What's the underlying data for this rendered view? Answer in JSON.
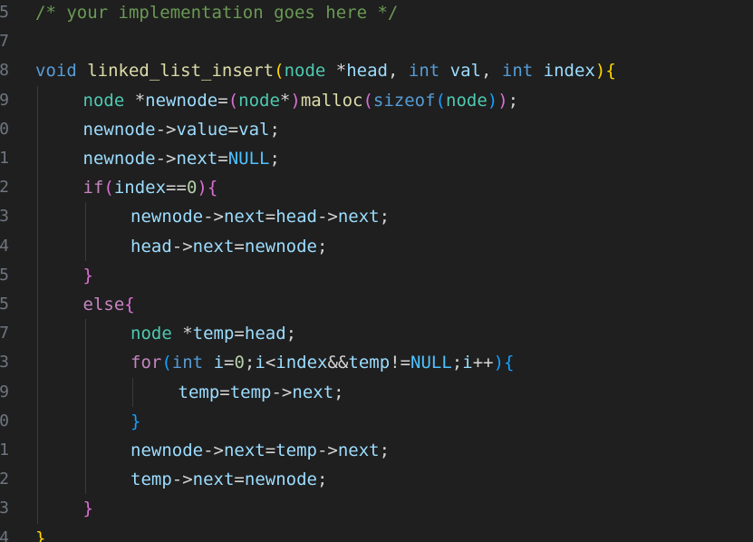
{
  "editor": {
    "lines": [
      {
        "num": "5",
        "indent": 0,
        "tokens": [
          {
            "t": "/* your implementation goes here */",
            "k": "comment"
          }
        ]
      },
      {
        "num": "7",
        "indent": 0,
        "tokens": []
      },
      {
        "num": "8",
        "indent": 0,
        "tokens": [
          {
            "t": "void",
            "k": "keyword"
          },
          {
            "t": " ",
            "k": "plain"
          },
          {
            "t": "linked_list_insert",
            "k": "func"
          },
          {
            "t": "(",
            "k": "brace1"
          },
          {
            "t": "node",
            "k": "type"
          },
          {
            "t": " *",
            "k": "plain"
          },
          {
            "t": "head",
            "k": "var"
          },
          {
            "t": ", ",
            "k": "plain"
          },
          {
            "t": "int",
            "k": "keyword"
          },
          {
            "t": " ",
            "k": "plain"
          },
          {
            "t": "val",
            "k": "var"
          },
          {
            "t": ", ",
            "k": "plain"
          },
          {
            "t": "int",
            "k": "keyword"
          },
          {
            "t": " ",
            "k": "plain"
          },
          {
            "t": "index",
            "k": "var"
          },
          {
            "t": ")",
            "k": "brace1"
          },
          {
            "t": "{",
            "k": "brace1"
          }
        ]
      },
      {
        "num": "9",
        "indent": 1,
        "tokens": [
          {
            "t": "node",
            "k": "type"
          },
          {
            "t": " *",
            "k": "plain"
          },
          {
            "t": "newnode",
            "k": "var"
          },
          {
            "t": "=",
            "k": "plain"
          },
          {
            "t": "(",
            "k": "brace2"
          },
          {
            "t": "node",
            "k": "type"
          },
          {
            "t": "*",
            "k": "plain"
          },
          {
            "t": ")",
            "k": "brace2"
          },
          {
            "t": "malloc",
            "k": "func"
          },
          {
            "t": "(",
            "k": "brace2"
          },
          {
            "t": "sizeof",
            "k": "keyword"
          },
          {
            "t": "(",
            "k": "brace3"
          },
          {
            "t": "node",
            "k": "type"
          },
          {
            "t": ")",
            "k": "brace3"
          },
          {
            "t": ")",
            "k": "brace2"
          },
          {
            "t": ";",
            "k": "plain"
          }
        ]
      },
      {
        "num": "0",
        "indent": 1,
        "tokens": [
          {
            "t": "newnode",
            "k": "var"
          },
          {
            "t": "->",
            "k": "plain"
          },
          {
            "t": "value",
            "k": "var"
          },
          {
            "t": "=",
            "k": "plain"
          },
          {
            "t": "val",
            "k": "var"
          },
          {
            "t": ";",
            "k": "plain"
          }
        ]
      },
      {
        "num": "1",
        "indent": 1,
        "tokens": [
          {
            "t": "newnode",
            "k": "var"
          },
          {
            "t": "->",
            "k": "plain"
          },
          {
            "t": "next",
            "k": "var"
          },
          {
            "t": "=",
            "k": "plain"
          },
          {
            "t": "NULL",
            "k": "const"
          },
          {
            "t": ";",
            "k": "plain"
          }
        ]
      },
      {
        "num": "2",
        "indent": 1,
        "tokens": [
          {
            "t": "if",
            "k": "control"
          },
          {
            "t": "(",
            "k": "brace2"
          },
          {
            "t": "index",
            "k": "var"
          },
          {
            "t": "==",
            "k": "plain"
          },
          {
            "t": "0",
            "k": "num"
          },
          {
            "t": ")",
            "k": "brace2"
          },
          {
            "t": "{",
            "k": "brace2"
          }
        ]
      },
      {
        "num": "3",
        "indent": 2,
        "tokens": [
          {
            "t": "newnode",
            "k": "var"
          },
          {
            "t": "->",
            "k": "plain"
          },
          {
            "t": "next",
            "k": "var"
          },
          {
            "t": "=",
            "k": "plain"
          },
          {
            "t": "head",
            "k": "var"
          },
          {
            "t": "->",
            "k": "plain"
          },
          {
            "t": "next",
            "k": "var"
          },
          {
            "t": ";",
            "k": "plain"
          }
        ]
      },
      {
        "num": "4",
        "indent": 2,
        "tokens": [
          {
            "t": "head",
            "k": "var"
          },
          {
            "t": "->",
            "k": "plain"
          },
          {
            "t": "next",
            "k": "var"
          },
          {
            "t": "=",
            "k": "plain"
          },
          {
            "t": "newnode",
            "k": "var"
          },
          {
            "t": ";",
            "k": "plain"
          }
        ]
      },
      {
        "num": "5",
        "indent": 1,
        "tokens": [
          {
            "t": "}",
            "k": "brace2"
          }
        ]
      },
      {
        "num": "5",
        "indent": 1,
        "tokens": [
          {
            "t": "else",
            "k": "control"
          },
          {
            "t": "{",
            "k": "brace2"
          }
        ]
      },
      {
        "num": "7",
        "indent": 2,
        "tokens": [
          {
            "t": "node",
            "k": "type"
          },
          {
            "t": " *",
            "k": "plain"
          },
          {
            "t": "temp",
            "k": "var"
          },
          {
            "t": "=",
            "k": "plain"
          },
          {
            "t": "head",
            "k": "var"
          },
          {
            "t": ";",
            "k": "plain"
          }
        ]
      },
      {
        "num": "3",
        "indent": 2,
        "tokens": [
          {
            "t": "for",
            "k": "control"
          },
          {
            "t": "(",
            "k": "brace3"
          },
          {
            "t": "int",
            "k": "keyword"
          },
          {
            "t": " ",
            "k": "plain"
          },
          {
            "t": "i",
            "k": "var"
          },
          {
            "t": "=",
            "k": "plain"
          },
          {
            "t": "0",
            "k": "num"
          },
          {
            "t": ";",
            "k": "plain"
          },
          {
            "t": "i",
            "k": "var"
          },
          {
            "t": "<",
            "k": "plain"
          },
          {
            "t": "index",
            "k": "var"
          },
          {
            "t": "&&",
            "k": "plain"
          },
          {
            "t": "temp",
            "k": "var"
          },
          {
            "t": "!=",
            "k": "plain"
          },
          {
            "t": "NULL",
            "k": "const"
          },
          {
            "t": ";",
            "k": "plain"
          },
          {
            "t": "i",
            "k": "var"
          },
          {
            "t": "++",
            "k": "plain"
          },
          {
            "t": ")",
            "k": "brace3"
          },
          {
            "t": "{",
            "k": "brace3"
          }
        ]
      },
      {
        "num": "9",
        "indent": 3,
        "tokens": [
          {
            "t": "temp",
            "k": "var"
          },
          {
            "t": "=",
            "k": "plain"
          },
          {
            "t": "temp",
            "k": "var"
          },
          {
            "t": "->",
            "k": "plain"
          },
          {
            "t": "next",
            "k": "var"
          },
          {
            "t": ";",
            "k": "plain"
          }
        ]
      },
      {
        "num": "0",
        "indent": 2,
        "tokens": [
          {
            "t": "}",
            "k": "brace3"
          }
        ]
      },
      {
        "num": "1",
        "indent": 2,
        "tokens": [
          {
            "t": "newnode",
            "k": "var"
          },
          {
            "t": "->",
            "k": "plain"
          },
          {
            "t": "next",
            "k": "var"
          },
          {
            "t": "=",
            "k": "plain"
          },
          {
            "t": "temp",
            "k": "var"
          },
          {
            "t": "->",
            "k": "plain"
          },
          {
            "t": "next",
            "k": "var"
          },
          {
            "t": ";",
            "k": "plain"
          }
        ]
      },
      {
        "num": "2",
        "indent": 2,
        "tokens": [
          {
            "t": "temp",
            "k": "var"
          },
          {
            "t": "->",
            "k": "plain"
          },
          {
            "t": "next",
            "k": "var"
          },
          {
            "t": "=",
            "k": "plain"
          },
          {
            "t": "newnode",
            "k": "var"
          },
          {
            "t": ";",
            "k": "plain"
          }
        ]
      },
      {
        "num": "3",
        "indent": 1,
        "tokens": [
          {
            "t": "}",
            "k": "brace2"
          }
        ]
      },
      {
        "num": "4",
        "indent": 0,
        "tokens": [
          {
            "t": "}",
            "k": "brace1"
          }
        ]
      }
    ]
  }
}
